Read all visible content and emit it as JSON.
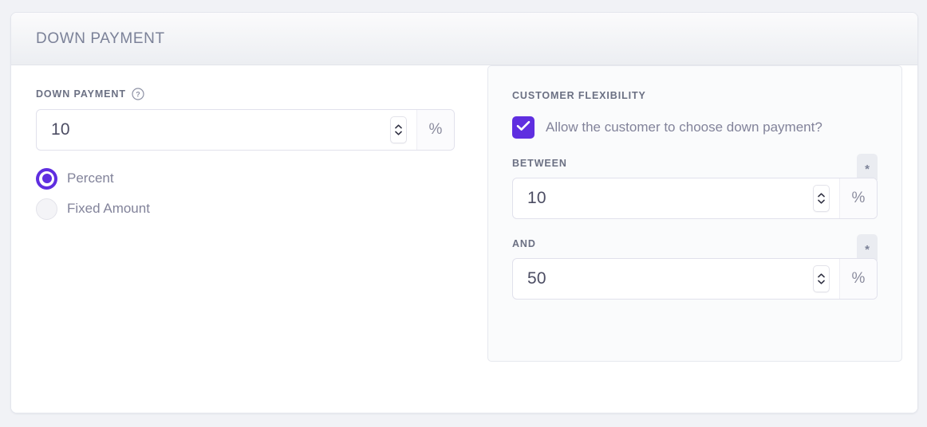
{
  "card": {
    "header_title": "DOWN PAYMENT"
  },
  "left": {
    "field_label": "DOWN PAYMENT",
    "help_icon": "question-circle-icon",
    "input": {
      "value": "10",
      "suffix": "%",
      "spinner_up_icon": "chevron-up-icon",
      "spinner_down_icon": "chevron-down-icon"
    },
    "radios": [
      {
        "label": "Percent",
        "selected": true
      },
      {
        "label": "Fixed Amount",
        "selected": false
      }
    ]
  },
  "right": {
    "panel_title": "CUSTOMER FLEXIBILITY",
    "checkbox": {
      "label": "Allow the customer to choose down payment?",
      "checked": true,
      "icon": "check-icon"
    },
    "fields": [
      {
        "label": "BETWEEN",
        "value": "10",
        "suffix": "%",
        "required_marker": "*"
      },
      {
        "label": "AND",
        "value": "50",
        "suffix": "%",
        "required_marker": "*"
      }
    ]
  },
  "colors": {
    "accent_purple": "#5f2ee0",
    "page_background": "#f1f2f6",
    "label_slate": "#6b7083",
    "header_title": "#7b8198",
    "value_text": "#4c4d63",
    "panel_background": "#fafbfc",
    "badge_background": "#eaecf1"
  }
}
